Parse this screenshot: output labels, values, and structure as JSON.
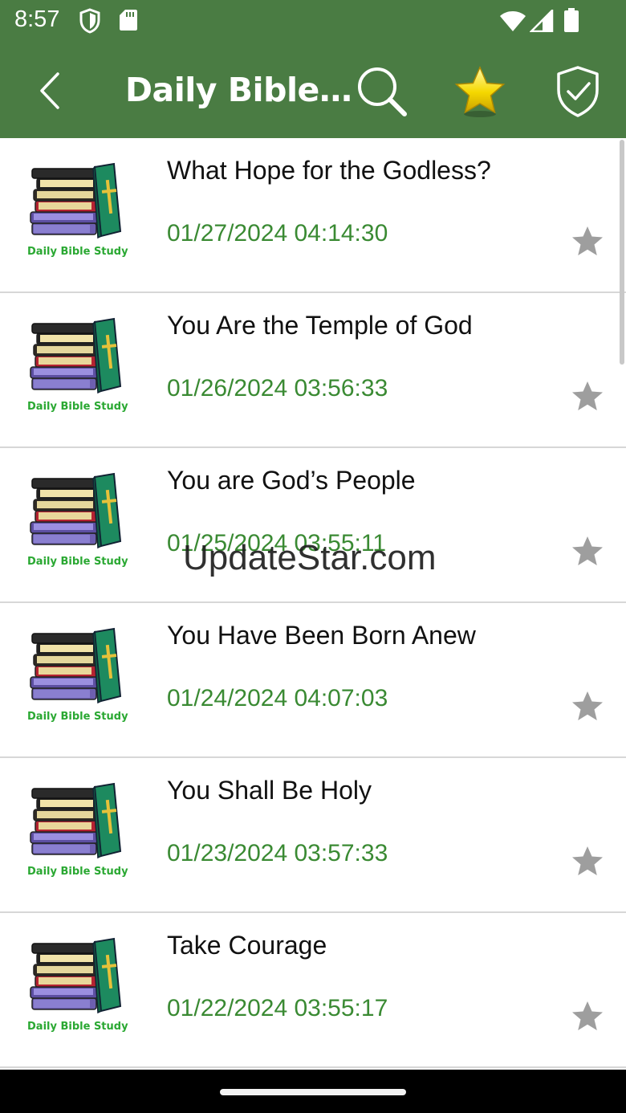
{
  "status_bar": {
    "time": "8:57",
    "icons": [
      "shield-icon",
      "sd-card-icon",
      "wifi-icon",
      "signal-icon",
      "battery-icon"
    ]
  },
  "app_bar": {
    "title": "Daily Bible…",
    "actions": [
      "back-arrow-icon",
      "search-icon",
      "star-favorites-icon",
      "shield-check-icon"
    ]
  },
  "thumbnail_caption": "Daily Bible Study",
  "items": [
    {
      "title": "What Hope for the Godless?",
      "date": "01/27/2024 04:14:30"
    },
    {
      "title": "You Are the Temple of God",
      "date": "01/26/2024 03:56:33"
    },
    {
      "title": "You are God’s People",
      "date": "01/25/2024 03:55:11"
    },
    {
      "title": "You Have Been Born Anew",
      "date": "01/24/2024 04:07:03"
    },
    {
      "title": "You Shall Be Holy",
      "date": "01/23/2024 03:57:33"
    },
    {
      "title": "Take Courage",
      "date": "01/22/2024 03:55:17"
    }
  ],
  "watermark": "UpdateStar.com",
  "colors": {
    "app_bar": "#4a7c43",
    "date_text": "#3a8a33",
    "star_inactive": "#9e9e9e",
    "star_active": "#f5d800"
  }
}
